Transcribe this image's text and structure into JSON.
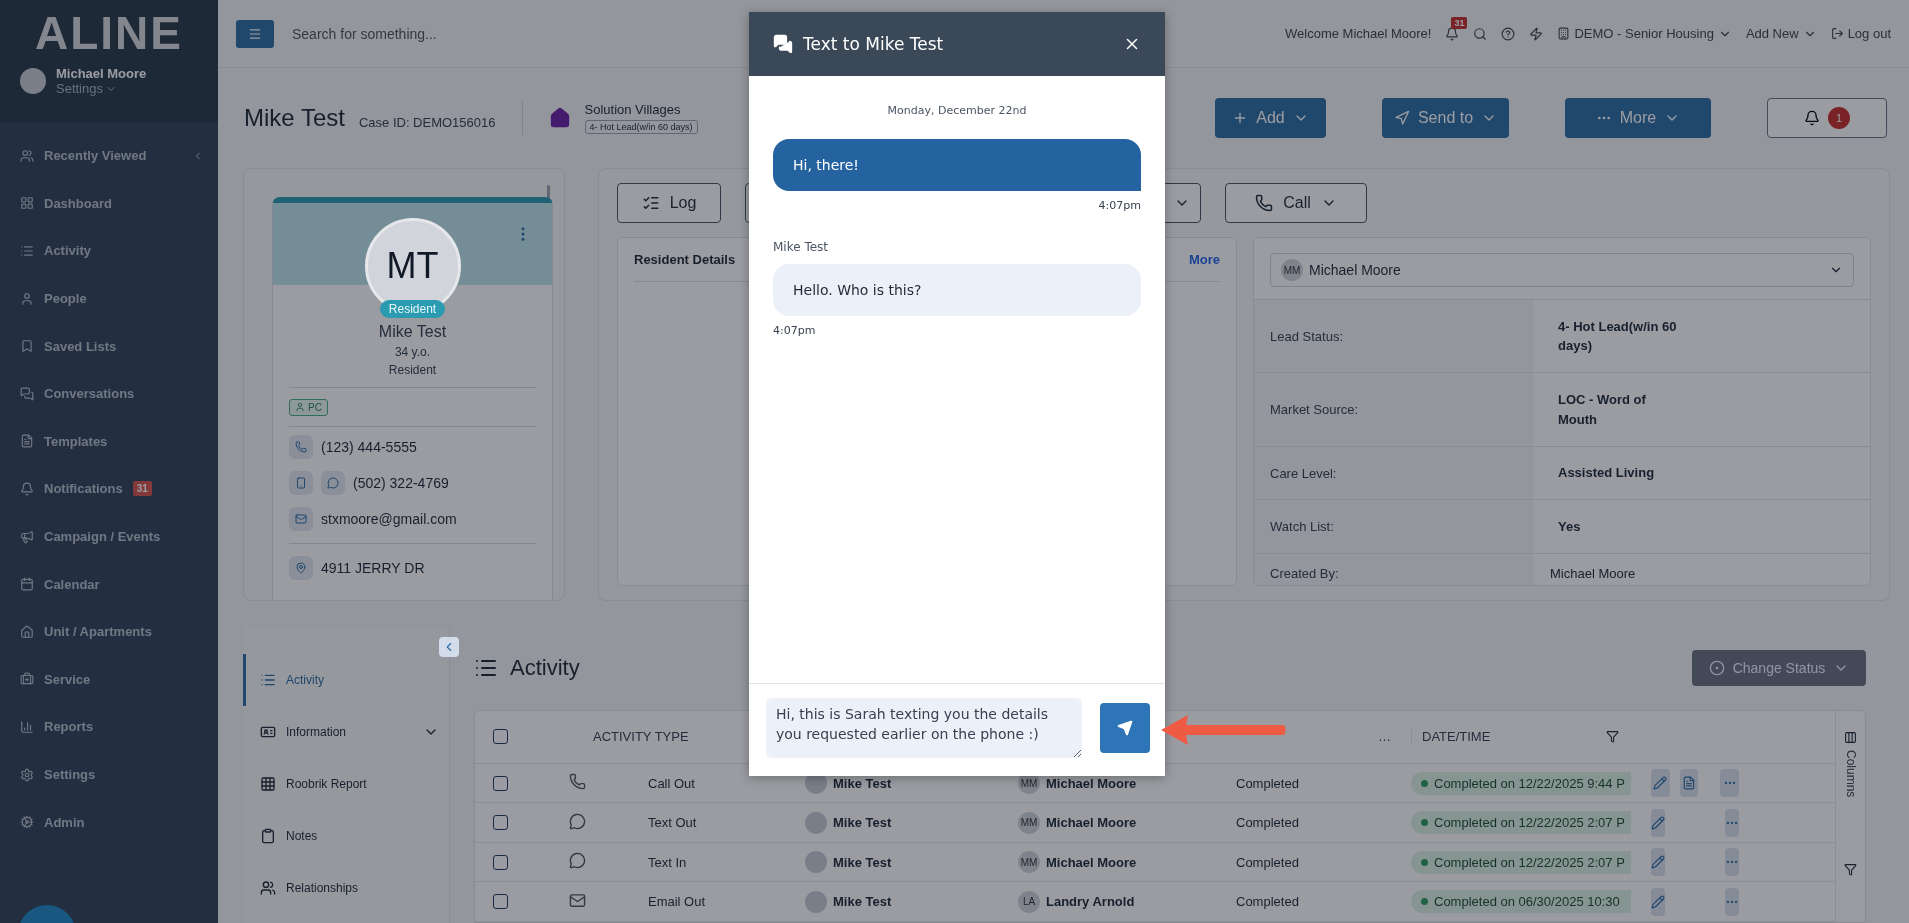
{
  "sidebar": {
    "logo": "ALINE",
    "user": {
      "name": "Michael Moore",
      "settings": "Settings"
    },
    "items": [
      {
        "label": "Recently Viewed"
      },
      {
        "label": "Dashboard"
      },
      {
        "label": "Activity"
      },
      {
        "label": "People"
      },
      {
        "label": "Saved Lists"
      },
      {
        "label": "Conversations"
      },
      {
        "label": "Templates"
      },
      {
        "label": "Notifications",
        "badge": "31"
      },
      {
        "label": "Campaign / Events"
      },
      {
        "label": "Calendar"
      },
      {
        "label": "Unit / Apartments"
      },
      {
        "label": "Service"
      },
      {
        "label": "Reports"
      },
      {
        "label": "Settings"
      },
      {
        "label": "Admin"
      }
    ]
  },
  "topbar": {
    "search_placeholder": "Search for something...",
    "welcome": "Welcome Michael Moore!",
    "notification_count": "31",
    "community": "DEMO - Senior Housing",
    "add_new": "Add New",
    "logout": "Log out"
  },
  "header": {
    "name": "Mike Test",
    "case_id": "Case ID: DEMO156016",
    "community": "Solution Villages",
    "lead_status": "4- Hot Lead(w/in 60 days)",
    "buttons": [
      "Add",
      "Send to",
      "More"
    ],
    "alert_count": "1"
  },
  "profile": {
    "initials": "MT",
    "role_badge": "Resident",
    "name": "Mike Test",
    "age": "34 y.o.",
    "type": "Resident",
    "tag": "PC",
    "phone": "(123) 444-5555",
    "mobile": "(502) 322-4769",
    "email": "stxmoore@gmail.com",
    "address": "4911 JERRY DR"
  },
  "actions": {
    "log": "Log",
    "call": "Call"
  },
  "resident_details": {
    "title": "Resident Details",
    "more": "More"
  },
  "assignee": {
    "initials": "MM",
    "name": "Michael Moore"
  },
  "details": [
    {
      "label": "Lead Status:",
      "value": "4- Hot Lead(w/in 60 days)",
      "kind": "bold"
    },
    {
      "label": "Market Source:",
      "value": "LOC - Word of Mouth",
      "kind": "bold"
    },
    {
      "label": "Care Level:",
      "value": "Assisted Living",
      "kind": "bold"
    },
    {
      "label": "Watch List:",
      "value": "Yes",
      "kind": "bold"
    },
    {
      "label": "Created By:",
      "value": "Michael Moore",
      "kind": "plain"
    }
  ],
  "activity_nav": [
    {
      "label": "Activity",
      "selected": true,
      "kind": "link"
    },
    {
      "label": "Information",
      "selected": false,
      "kind": "group"
    },
    {
      "label": "Roobrik Report",
      "selected": false,
      "kind": "link"
    },
    {
      "label": "Notes",
      "selected": false,
      "kind": "link"
    },
    {
      "label": "Relationships",
      "selected": false,
      "kind": "link"
    }
  ],
  "activity": {
    "title": "Activity",
    "change_status": "Change Status",
    "columns_label": "Columns",
    "table": {
      "header_checked": false,
      "columns": [
        "ACTIVITY TYPE",
        "…",
        "DATE/TIME"
      ],
      "rows": [
        {
          "checked": false,
          "kind": "call",
          "type": "Call Out",
          "contact": "Mike Test",
          "user_initials": "MM",
          "user": "Michael Moore",
          "status": "Completed",
          "datetime": "Completed on 12/22/2025 9:44 P",
          "has_document": true
        },
        {
          "checked": false,
          "kind": "text",
          "type": "Text Out",
          "contact": "Mike Test",
          "user_initials": "MM",
          "user": "Michael Moore",
          "status": "Completed",
          "datetime": "Completed on 12/22/2025 2:07 P",
          "has_document": false
        },
        {
          "checked": false,
          "kind": "text",
          "type": "Text In",
          "contact": "Mike Test",
          "user_initials": "MM",
          "user": "Michael Moore",
          "status": "Completed",
          "datetime": "Completed on 12/22/2025 2:07 P",
          "has_document": false
        },
        {
          "checked": false,
          "kind": "email",
          "type": "Email Out",
          "contact": "Mike Test",
          "user_initials": "LA",
          "user": "Landry Arnold",
          "status": "Completed",
          "datetime": "Completed on 06/30/2025 10:30",
          "has_document": false
        }
      ]
    }
  },
  "modal": {
    "title": "Text to Mike Test",
    "date": "Monday, December 22nd",
    "messages": [
      {
        "kind": "sent",
        "text": "Hi, there!",
        "time": "4:07pm"
      },
      {
        "kind": "received",
        "sender": "Mike Test",
        "text": "Hello. Who is this?",
        "time": "4:07pm"
      }
    ],
    "draft": "Hi, this is Sarah texting you the details you requested earlier on the phone :)"
  }
}
